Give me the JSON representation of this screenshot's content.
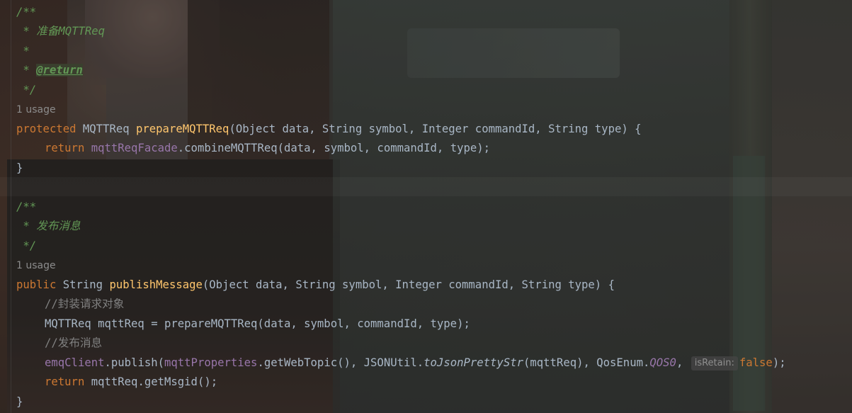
{
  "theme": {
    "keyword_color": "#cc7832",
    "function_color": "#ffc66d",
    "field_color": "#9876aa",
    "doc_color": "#629755",
    "comment_color": "#808080",
    "text_color": "#a9b7c6"
  },
  "editor": {
    "doc1": {
      "open": "/**",
      "desc": " * 准备MQTTReq",
      "blank": " *",
      "star": " * ",
      "tag": "@return",
      "close": " */"
    },
    "usage1": "1 usage",
    "method1": {
      "modifier": "protected",
      "return_type": " MQTTReq ",
      "name": "prepareMQTTReq",
      "params": "(Object data, String symbol, Integer commandId, String type) ",
      "open_brace": "{",
      "body_kw": "return",
      "body_field": " mqttReqFacade",
      "body_rest": ".combineMQTTReq(data, symbol, commandId, type);",
      "close_brace": "}"
    },
    "doc2": {
      "open": "/**",
      "desc": " * 发布消息",
      "close": " */"
    },
    "usage2": "1 usage",
    "method2": {
      "modifier": "public",
      "return_type": " String ",
      "name": "publishMessage",
      "params": "(Object data, String symbol, Integer commandId, String type) ",
      "open_brace": "{",
      "comment1": "//封装请求对象",
      "line_assign": "MQTTReq mqttReq = prepareMQTTReq(data, symbol, commandId, type);",
      "comment2": "//发布消息",
      "pub_field": "emqClient",
      "pub_call": ".publish(",
      "pub_field2": "mqttProperties",
      "pub_call2": ".getWebTopic(), JSONUtil.",
      "pub_static": "toJsonPrettyStr",
      "pub_call3": "(mqttReq), QosEnum.",
      "pub_enum": "QOS0",
      "pub_sep": ", ",
      "hint": "isRetain:",
      "pub_false": "false",
      "pub_end": ");",
      "ret_kw": "return",
      "ret_rest": " mqttReq.getMsgid();",
      "close_brace": "}"
    }
  }
}
